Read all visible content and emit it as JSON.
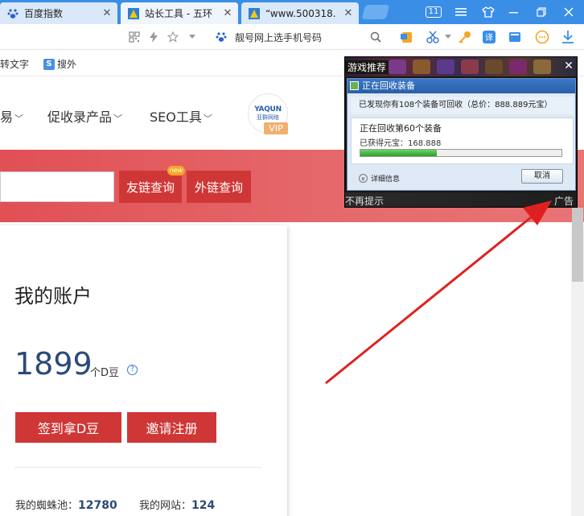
{
  "browser": {
    "tabs": [
      {
        "label": "百度指数"
      },
      {
        "label": "站长工具 - 五环"
      },
      {
        "label": "“www.500318."
      }
    ],
    "tab_close": "✕",
    "tab_count": "11",
    "address_text": "靓号网上选手机号码"
  },
  "bookmarks": [
    {
      "label": "转文字"
    },
    {
      "label": "搜外"
    }
  ],
  "nav": {
    "items": [
      {
        "label": "易"
      },
      {
        "label": "促收录产品"
      },
      {
        "label": "SEO工具"
      }
    ],
    "logo_text": "YAQUN",
    "logo_sub": "亚群网络",
    "vip": "VIP"
  },
  "banner": {
    "friend_link_button": "友链查询",
    "backlink_button": "外链查询",
    "new_tag": "new"
  },
  "account": {
    "title": "我的账户",
    "balance": "1899",
    "unit": "个D豆",
    "help": "?",
    "signin_button": "签到拿D豆",
    "invite_button": "邀请注册",
    "spider_label": "我的蜘蛛池：",
    "spider_value": "12780",
    "sites_label": "我的网站：",
    "sites_value": "124"
  },
  "popup": {
    "title": "游戏推荐",
    "close": "✕",
    "dialog_title": "正在回收装备",
    "found_msg": "已发现你有108个装备可回收（总价：888.889元宝）",
    "current": "正在回收第60个装备",
    "earned": "已获得元宝：168.888",
    "progress": 0.38,
    "details": "详细信息",
    "cancel": "取消",
    "dont_show": "不再提示",
    "ad": "广告"
  },
  "colors": {
    "browser_blue": "#3a8ee6",
    "banner_red": "#e05055",
    "button_red": "#cf3737",
    "balance_blue": "#2b4a78",
    "arrow_red": "#e02020"
  }
}
